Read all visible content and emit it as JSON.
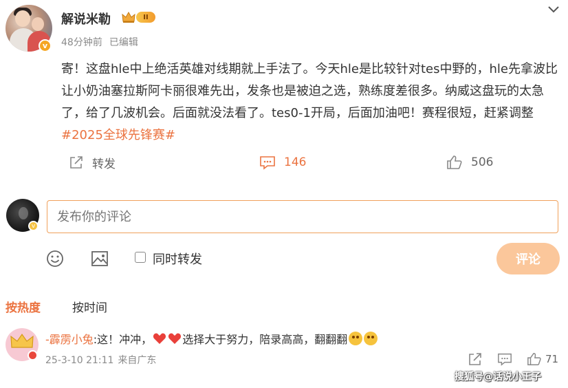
{
  "post": {
    "author": "解说米勒",
    "level_badge": "II",
    "time": "48分钟前",
    "edited": "已编辑",
    "body": "寄！这盘hle中上绝活英雄对线期就上手法了。今天hle是比较针对tes中野的，hle先拿波比让小奶油塞拉斯阿卡丽很难先出，发条也是被迫之选，熟练度差很多。纳威这盘玩的太急了，给了几波机会。后面就没法看了。tes0-1开局，后面加油吧！赛程很短，赶紧调整 ",
    "hashtag": "#2025全球先锋赛#",
    "verified_mark": "v"
  },
  "actions": {
    "forward_label": "转发",
    "comment_count": "146",
    "like_count": "506"
  },
  "composer": {
    "placeholder": "发布你的评论",
    "repost_label": "同时转发",
    "submit_label": "评论",
    "badge": "v"
  },
  "sort": {
    "hot_label": "按热度",
    "time_label": "按时间"
  },
  "comments": [
    {
      "user": "-霹雳小兔",
      "text_before": ":这！冲冲，",
      "text_after": "选择大于努力，陪录高高，翻翻翻",
      "date": "25-3-10 21:11",
      "location": "来自广东",
      "like_count": "71"
    }
  ],
  "watermark": "搜狐号@话说小王子",
  "colors": {
    "accent": "#eb7340",
    "submit_bg": "#fbc79b",
    "input_border": "#f0a05a"
  }
}
